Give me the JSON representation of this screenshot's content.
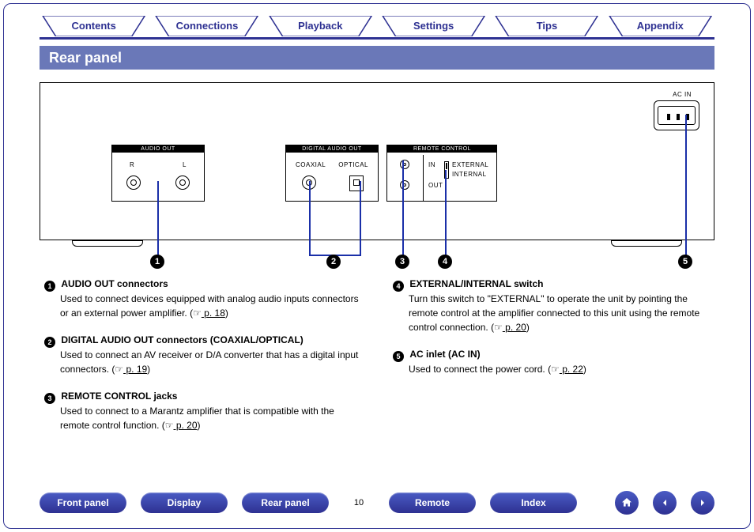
{
  "top_tabs": [
    "Contents",
    "Connections",
    "Playback",
    "Settings",
    "Tips",
    "Appendix"
  ],
  "section_title": "Rear panel",
  "diagram": {
    "ac_in_label": "AC IN",
    "blocks": {
      "audio_out": {
        "header": "AUDIO OUT",
        "r": "R",
        "l": "L"
      },
      "digital_out": {
        "header": "DIGITAL AUDIO OUT",
        "coaxial": "COAXIAL",
        "optical": "OPTICAL"
      },
      "remote_control": {
        "header": "REMOTE CONTROL",
        "in": "IN",
        "out": "OUT",
        "external": "EXTERNAL",
        "internal": "INTERNAL"
      }
    },
    "callouts": [
      "1",
      "2",
      "3",
      "4",
      "5"
    ]
  },
  "descriptions": {
    "left": [
      {
        "num": "1",
        "title": "AUDIO OUT connectors",
        "body": "Used to connect devices equipped with analog audio inputs connectors or an external power amplifier.  (",
        "ref": " p. 18",
        "tail": ")"
      },
      {
        "num": "2",
        "title": "DIGITAL AUDIO OUT connectors (COAXIAL/OPTICAL)",
        "body": "Used to connect an AV receiver or D/A converter that has a digital input connectors.  (",
        "ref": " p. 19",
        "tail": ")"
      },
      {
        "num": "3",
        "title": "REMOTE CONTROL jacks",
        "body": "Used to connect to a Marantz amplifier that is compatible with the remote control function.  (",
        "ref": " p. 20",
        "tail": ")"
      }
    ],
    "right": [
      {
        "num": "4",
        "title": "EXTERNAL/INTERNAL switch",
        "body": "Turn this switch to \"EXTERNAL\" to operate the unit by pointing the remote control at the amplifier connected to this unit using the remote control connection.  (",
        "ref": " p. 20",
        "tail": ")"
      },
      {
        "num": "5",
        "title": "AC inlet (AC IN)",
        "body": "Used to connect the power cord.  (",
        "ref": " p. 22",
        "tail": ")"
      }
    ]
  },
  "bottom_buttons": [
    "Front panel",
    "Display",
    "Rear panel",
    "Remote",
    "Index"
  ],
  "page_number": "10"
}
